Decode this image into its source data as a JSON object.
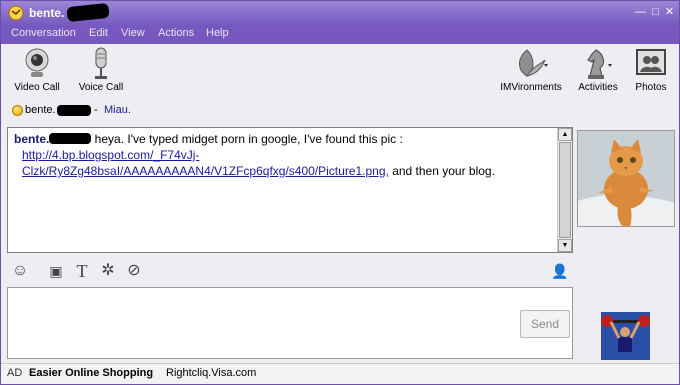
{
  "window": {
    "title": "bente.",
    "controls": {
      "minimize": "—",
      "maximize": "□",
      "close": "✕"
    }
  },
  "menu": [
    "Conversation",
    "Edit",
    "View",
    "Actions",
    "Help"
  ],
  "toolbar": {
    "video_call": "Video Call",
    "voice_call": "Voice Call",
    "imvironments": "IMVironments",
    "activities": "Activities",
    "photos": "Photos"
  },
  "status": {
    "name": "bente.",
    "separator": "-",
    "message": "Miau."
  },
  "conversation": {
    "sender": "bente.",
    "text_before": " heya. I've typed midget porn in google, I've found this pic :",
    "link_line1": "http://4.bp.blogspot.com/_F74vJj-",
    "link_line2": "Clzk/Ry8Zg48bsaI/AAAAAAAAAN4/V1ZFcp6qfxg/s400/Picture1.png",
    "link_comma": ",",
    "text_after": " and then your blog."
  },
  "input": {
    "value": "",
    "send_label": "Send"
  },
  "ad": {
    "tag": "AD",
    "headline": "Easier Online Shopping",
    "source": "Rightcliq.Visa.com"
  },
  "icons": {
    "app": "yahoo-messenger-icon",
    "video": "webcam-icon",
    "voice": "microphone-icon",
    "imvironments": "leaf-icon",
    "activities": "chess-knight-icon",
    "photos": "photo-frame-icon",
    "emoticon": "smiley-icon",
    "audibles": "speech-bubble-icon",
    "font": "text-format-icon",
    "plugins": "gear-icon",
    "attach": "paperclip-icon",
    "contact": "user-arrow-icon"
  },
  "colors": {
    "titlebar": "#7658bf",
    "link": "#1a1a9c",
    "sender": "#1a1a6c"
  }
}
